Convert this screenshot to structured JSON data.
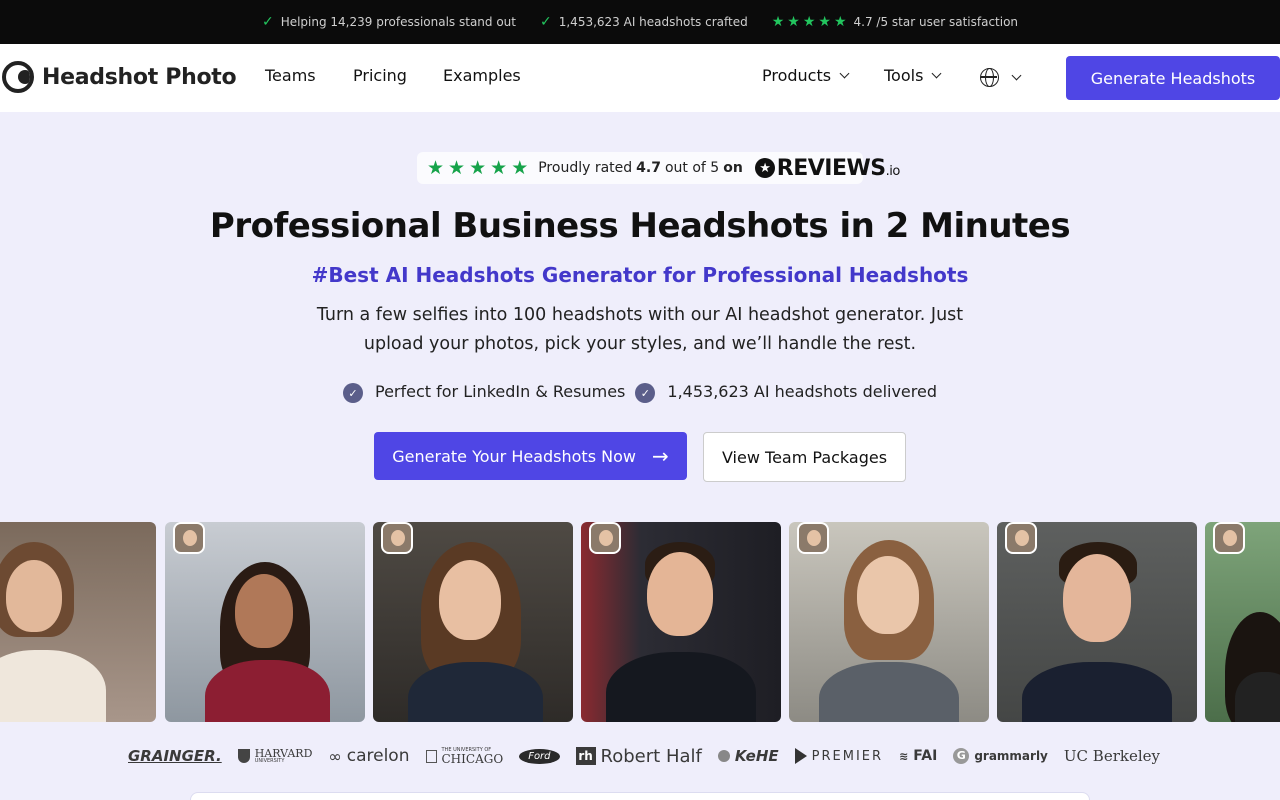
{
  "topbar": {
    "item1": "Helping 14,239 professionals stand out",
    "item2": "1,453,623 AI headshots crafted",
    "item3": "4.7 /5 star user satisfaction"
  },
  "nav": {
    "logo": "Headshot Photo",
    "links": [
      "Teams",
      "Pricing",
      "Examples"
    ],
    "products": "Products",
    "tools": "Tools",
    "cta": "Generate Headshots"
  },
  "hero": {
    "rating_prefix": "Proudly rated",
    "rating_value": "4.7",
    "rating_suffix": "out of 5",
    "rating_on": "on",
    "reviews_brand": "REVIEWS",
    "reviews_tld": ".io",
    "title": "Professional Business Headshots in 2 Minutes",
    "subtitle": "#Best AI Headshots Generator for Professional Headshots",
    "description": "Turn a few selfies into 100 headshots with our AI headshot generator. Just upload your photos, pick your styles, and we’ll handle the rest.",
    "bullet1": "Perfect for LinkedIn & Resumes",
    "bullet2": "1,453,623 AI headshots delivered",
    "cta_primary": "Generate Your Headshots Now",
    "cta_secondary": "View Team Packages"
  },
  "logos": [
    "GRAINGER.",
    "HARVARD",
    "carelon",
    "CHICAGO",
    "Ford",
    "Robert Half",
    "KeHE",
    "PREMIER",
    "FAI",
    "grammarly",
    "UC Berkeley"
  ],
  "logo_subtext": {
    "harvard": "UNIVERSITY",
    "chicago": "THE UNIVERSITY OF"
  },
  "icons": {
    "check": "✓",
    "star": "★",
    "arrow": "→"
  },
  "colors": {
    "accent": "#4f46e5",
    "subtitle": "#4338ca",
    "star_green": "#22c55e",
    "hero_bg": "#efeefb"
  }
}
